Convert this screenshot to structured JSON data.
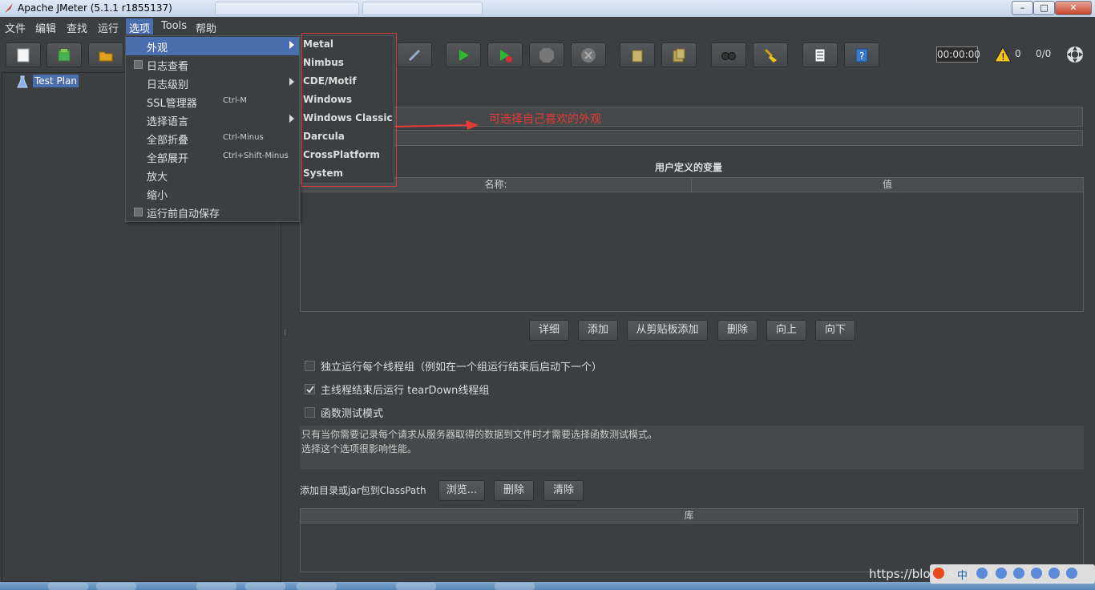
{
  "window": {
    "title": "Apache JMeter (5.1.1 r1855137)",
    "minimize": "–",
    "maximize": "□",
    "close": "✕"
  },
  "menubar": [
    {
      "label": "文件"
    },
    {
      "label": "编辑"
    },
    {
      "label": "查找"
    },
    {
      "label": "运行"
    },
    {
      "label": "选项"
    },
    {
      "label": "Tools"
    },
    {
      "label": "帮助"
    }
  ],
  "options_menu": {
    "items": [
      {
        "label": "外观",
        "shortcut": "",
        "submenu": true
      },
      {
        "label": "日志查看",
        "shortcut": "",
        "checkbox": true
      },
      {
        "label": "日志级别",
        "shortcut": "",
        "submenu": true
      },
      {
        "label": "SSL管理器",
        "shortcut": "Ctrl-M"
      },
      {
        "label": "选择语言",
        "shortcut": "",
        "submenu": true
      },
      {
        "label": "全部折叠",
        "shortcut": "Ctrl-Minus"
      },
      {
        "label": "全部展开",
        "shortcut": "Ctrl+Shift-Minus"
      },
      {
        "label": "放大",
        "shortcut": ""
      },
      {
        "label": "缩小",
        "shortcut": ""
      },
      {
        "label": "运行前自动保存",
        "shortcut": "",
        "checkbox": true
      }
    ]
  },
  "look_and_feel_submenu": [
    "Metal",
    "Nimbus",
    "CDE/Motif",
    "Windows",
    "Windows Classic",
    "Darcula",
    "CrossPlatform",
    "System"
  ],
  "annotation": "可选择自己喜欢的外观",
  "toolbar": {
    "timer": "00:00:00",
    "warnings": "0",
    "threads": "0/0"
  },
  "tree": {
    "root": "Test Plan"
  },
  "test_plan": {
    "variables_title": "用户定义的变量",
    "col_name": "名称:",
    "col_value": "值",
    "buttons": {
      "detail": "详细",
      "add": "添加",
      "add_clipboard": "从剪贴板添加",
      "delete": "删除",
      "up": "向上",
      "down": "向下"
    },
    "checks": [
      {
        "label": "独立运行每个线程组（例如在一个组运行结束后启动下一个）",
        "checked": false
      },
      {
        "label": "主线程结束后运行 tearDown线程组",
        "checked": true
      },
      {
        "label": "函数测试模式",
        "checked": false
      }
    ],
    "desc_line1": "只有当你需要记录每个请求从服务器取得的数据到文件时才需要选择函数测试模式。",
    "desc_line2": "选择这个选项很影响性能。",
    "classpath_label": "添加目录或jar包到ClassPath",
    "browse": "浏览...",
    "cp_delete": "删除",
    "cp_clear": "清除",
    "lib_col": "库"
  },
  "watermark": "https://blog.csdn.net",
  "tray": {
    "ime": "中"
  },
  "colors": {
    "background": "#3c3f41",
    "selection": "#4b6eaf",
    "annotation": "#e83838"
  }
}
